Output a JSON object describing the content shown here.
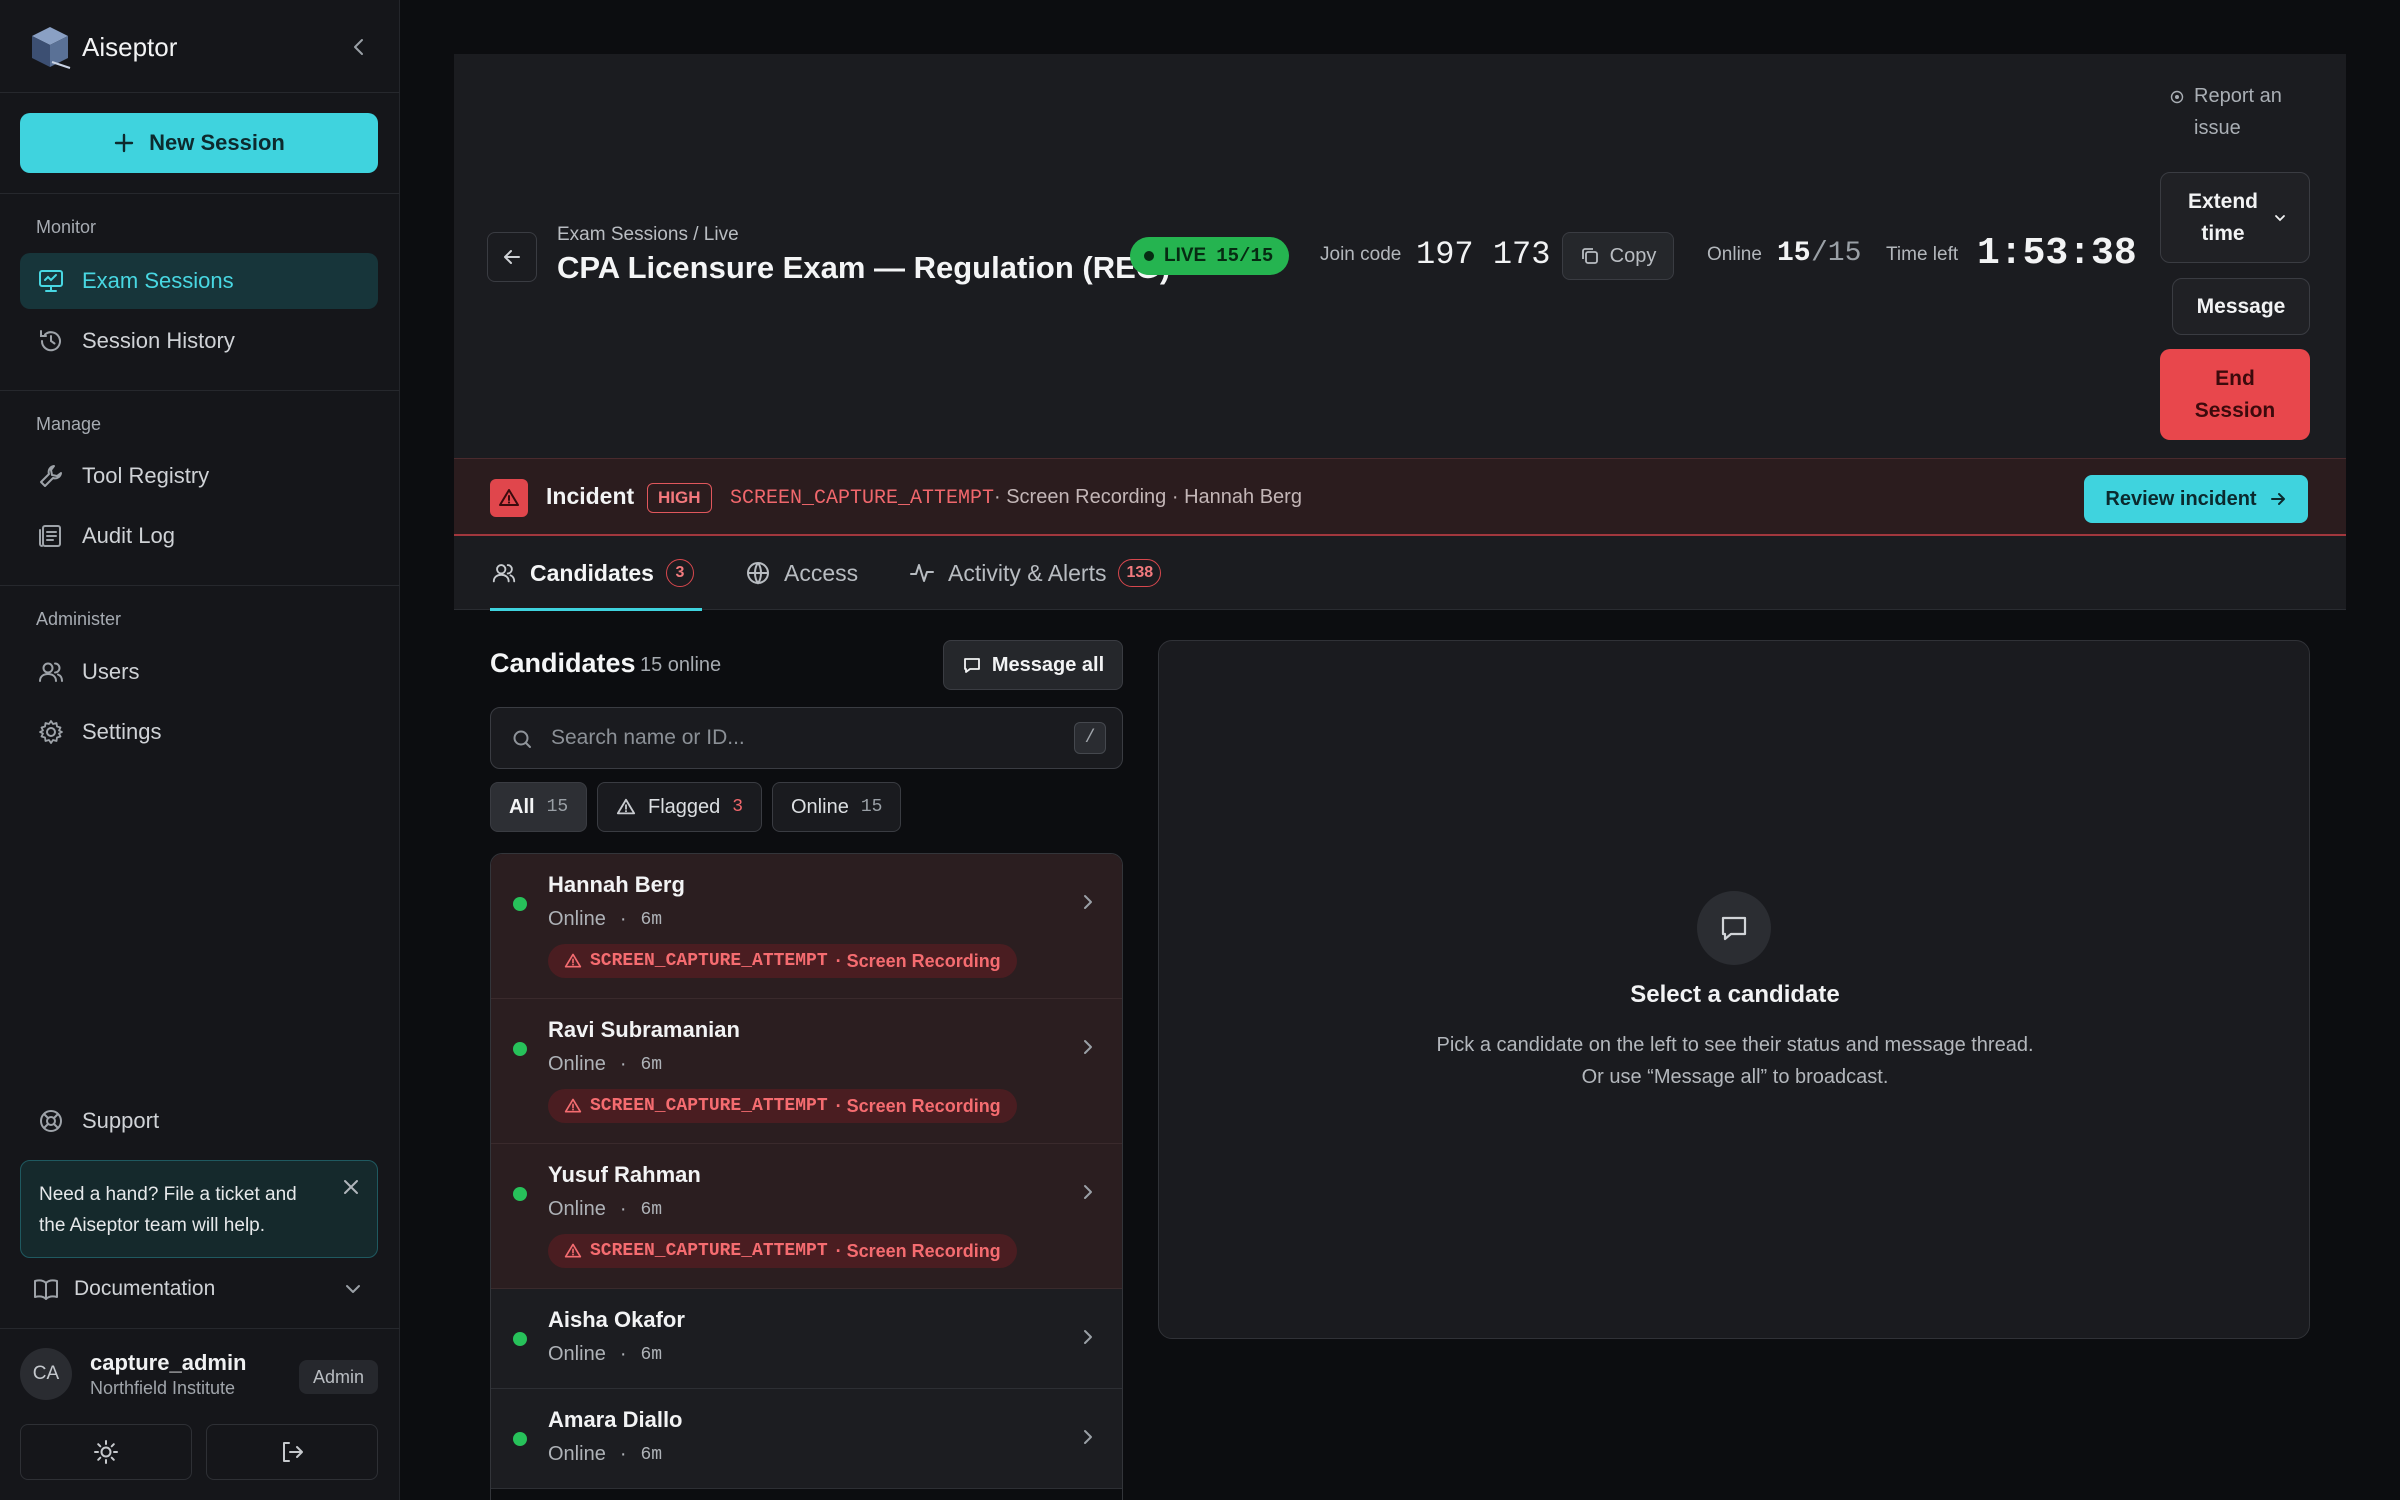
{
  "brand": {
    "name": "Aiseptor"
  },
  "sidebar": {
    "new_session": "New Session",
    "sections": [
      {
        "label": "Monitor",
        "items": [
          {
            "label": "Exam Sessions",
            "icon": "monitor-icon",
            "active": true
          },
          {
            "label": "Session History",
            "icon": "history-icon"
          }
        ]
      },
      {
        "label": "Manage",
        "items": [
          {
            "label": "Tool Registry",
            "icon": "wrench-icon"
          },
          {
            "label": "Audit Log",
            "icon": "log-icon"
          }
        ]
      },
      {
        "label": "Administer",
        "items": [
          {
            "label": "Users",
            "icon": "users-icon"
          },
          {
            "label": "Settings",
            "icon": "gear-icon"
          }
        ]
      }
    ],
    "support": "Support",
    "help_text": "Need a hand? File a ticket and the Aiseptor team will help.",
    "documentation": "Documentation",
    "user": {
      "initials": "CA",
      "name": "capture_admin",
      "org": "Northfield Institute",
      "role": "Admin"
    }
  },
  "header": {
    "breadcrumb": "Exam Sessions / Live",
    "title": "CPA Licensure Exam — Regulation (REG)",
    "live_label": "LIVE",
    "live_count": "15/15",
    "join_code_label": "Join code",
    "join_code": "197 173",
    "copy_label": "Copy",
    "online_label": "Online",
    "online_now": "15",
    "online_total": "/15",
    "time_left_label": "Time left",
    "time_left": "1:53:38",
    "report": "Report an issue",
    "extend_time": "Extend time",
    "message": "Message",
    "end_session": "End Session"
  },
  "incident": {
    "label": "Incident",
    "severity": "HIGH",
    "code": "SCREEN_CAPTURE_ATTEMPT",
    "rest": "· Screen Recording · Hannah Berg",
    "review": "Review incident"
  },
  "tabs": [
    {
      "label": "Candidates",
      "count": "3",
      "icon": "users-icon",
      "active": true
    },
    {
      "label": "Access",
      "icon": "globe-icon"
    },
    {
      "label": "Activity & Alerts",
      "count": "138",
      "icon": "activity-icon"
    }
  ],
  "candidates": {
    "title": "Candidates",
    "subtitle": "15 online",
    "message_all": "Message all",
    "search_placeholder": "Search name or ID...",
    "search_shortcut": "/",
    "filters": [
      {
        "label": "All",
        "count": "15"
      },
      {
        "label": "Flagged",
        "count": "3"
      },
      {
        "label": "Online",
        "count": "15"
      }
    ],
    "rows": [
      {
        "name": "Hannah Berg",
        "status": "Online",
        "time": "6m",
        "alert_code": "SCREEN_CAPTURE_ATTEMPT",
        "alert_rest": "· Screen Recording"
      },
      {
        "name": "Ravi Subramanian",
        "status": "Online",
        "time": "6m",
        "alert_code": "SCREEN_CAPTURE_ATTEMPT",
        "alert_rest": "· Screen Recording"
      },
      {
        "name": "Yusuf Rahman",
        "status": "Online",
        "time": "6m",
        "alert_code": "SCREEN_CAPTURE_ATTEMPT",
        "alert_rest": "· Screen Recording"
      },
      {
        "name": "Aisha Okafor",
        "status": "Online",
        "time": "6m"
      },
      {
        "name": "Amara Diallo",
        "status": "Online",
        "time": "6m"
      }
    ],
    "dot_separator": "·"
  },
  "detail": {
    "title": "Select a candidate",
    "description": "Pick a candidate on the left to see their status and message thread. Or use “Message all” to broadcast."
  },
  "colors": {
    "accent": "#3fd3de",
    "live": "#25b450",
    "danger": "#e8474c"
  }
}
